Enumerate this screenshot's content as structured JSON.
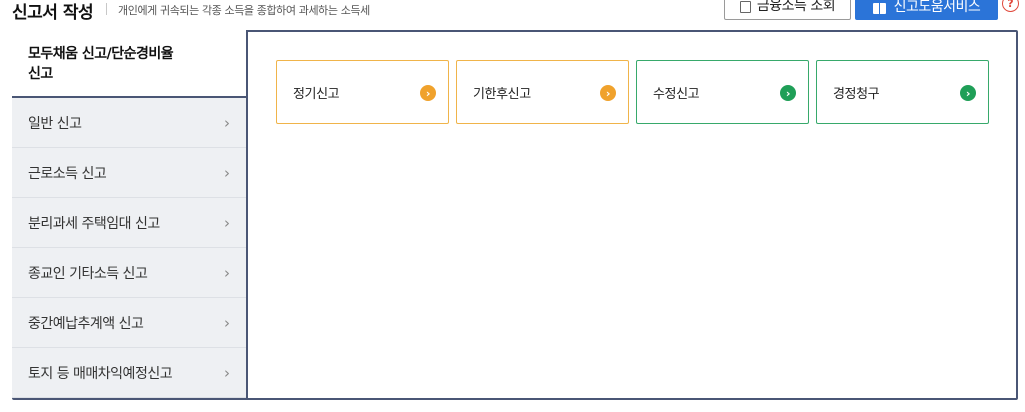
{
  "header": {
    "title": "신고서 작성",
    "description": "개인에게 귀속되는 각종 소득을 종합하여 과세하는 소득세",
    "finance_button": "금융소득 조회",
    "help_button": "신고도움서비스",
    "help_icon": "?"
  },
  "sidebar": {
    "active_line1": "모두채움 신고/단순경비율",
    "active_line2": "신고",
    "items": [
      {
        "label": "일반 신고"
      },
      {
        "label": "근로소득 신고"
      },
      {
        "label": "분리과세 주택임대 신고"
      },
      {
        "label": "종교인 기타소득 신고"
      },
      {
        "label": "중간예납추계액 신고"
      },
      {
        "label": "토지 등 매매차익예정신고"
      }
    ],
    "chevron": "›"
  },
  "cards": [
    {
      "label": "정기신고",
      "color": "#f0a22c"
    },
    {
      "label": "기한후신고",
      "color": "#f0a22c"
    },
    {
      "label": "수정신고",
      "color": "#1f9f57"
    },
    {
      "label": "경정청구",
      "color": "#1f9f57"
    }
  ],
  "icons": {
    "arrow": "›"
  }
}
